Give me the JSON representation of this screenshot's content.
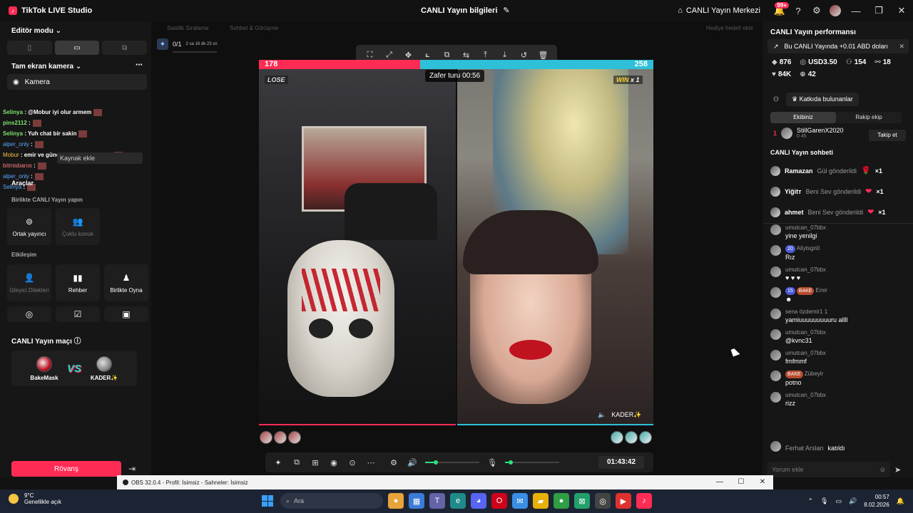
{
  "titlebar": {
    "app_title": "TikTok LIVE Studio",
    "center_title": "CANLI Yayın bilgileri",
    "center_btn": "CANLI Yayın Merkezi",
    "notif_count": "99+"
  },
  "left": {
    "editor_mode": "Editör modu",
    "fullscreen_camera": "Tam ekran kamera",
    "camera_item": "Kamera",
    "source_add": "Kaynak ekle",
    "tools": "Araçlar",
    "chat_overlay": [
      {
        "user": "Selinya",
        "text": ": @Mobur iyi olur armem",
        "ucls": "kg"
      },
      {
        "user": "pins2112",
        "text": ":",
        "ucls": "kg"
      },
      {
        "user": "Selinya",
        "text": ": Yuh chat bir sakin",
        "ucls": "kg"
      },
      {
        "user": "alper_only",
        "text": ":",
        "ucls": "kb"
      },
      {
        "user": "Mobur",
        "text": ": emir ve güneşten bahsediyorum",
        "ucls": "ky"
      },
      {
        "user": "bitmisbaros",
        "text": ":",
        "ucls": "km"
      },
      {
        "user": "alper_only",
        "text": ":",
        "ucls": "kb"
      },
      {
        "user": "Selinya",
        "text": ":",
        "ucls": "kb"
      }
    ],
    "together_title": "Birlikte CANLI Yayın yapın",
    "together_tiles": [
      {
        "label": "Ortak yayıncı",
        "icon": "⊚",
        "dim": false
      },
      {
        "label": "Çoklu konuk",
        "icon": "👥",
        "dim": true
      }
    ],
    "interaction_title": "Etkileşim",
    "interaction_tiles": [
      {
        "label": "İzleyici Dilekleri",
        "icon": "👤",
        "dim": true
      },
      {
        "label": "Rehber",
        "icon": "▮▮",
        "dim": false
      },
      {
        "label": "Birlikte Oyna",
        "icon": "♟",
        "dim": false
      }
    ],
    "match_title": "CANLI Yayın maçı",
    "match_left": "BakeMask",
    "match_right": "KADER✨",
    "vs": "VS",
    "rematch": "Rövanş"
  },
  "stage": {
    "faint_labels": [
      "Saatlik Sıralama",
      "Sohbet & Görüşme",
      "Hediye hedefi ekle"
    ],
    "goal_count": "0/1",
    "goal_time": "2 sa 16 dk 23 sn",
    "score_left": "178",
    "score_right": "258",
    "round_timer": "Zafer turu 00:56",
    "lose_label": "LOSE",
    "win_label": "WIN",
    "win_mult": "x 1",
    "opponent_name": "KADER✨",
    "live_time": "01:43:42",
    "toolbar_icons": [
      "⛶",
      "⤢",
      "✥",
      "⟀",
      "⧉",
      "⇆",
      "⤒",
      "⤓",
      "↺",
      "🗑"
    ],
    "controls": {
      "volume_level": 0.2,
      "mic_level": 0.1
    }
  },
  "right": {
    "perf_title": "CANLI Yayın performansı",
    "promo": "Bu CANLI Yayında +0.01 ABD doları",
    "stats_row1": [
      {
        "icon": "◆",
        "value": "876"
      },
      {
        "icon": "◎",
        "value": "USD3.50"
      },
      {
        "icon": "⚇",
        "value": "154"
      },
      {
        "icon": "⚯",
        "value": "18"
      }
    ],
    "stats_row2": [
      {
        "icon": "♥",
        "value": "84K"
      },
      {
        "icon": "⊕",
        "value": "42"
      }
    ],
    "contributors": "Katkıda bulunanlar",
    "tab_us": "Ekibiniz",
    "tab_rival": "Rakip ekip",
    "leader_rank": "1",
    "leader_name": "StillGarenX2020",
    "leader_sub": "0  45",
    "follow": "Takip et",
    "chat_title": "CANLI Yayın sohbeti",
    "gifts": [
      {
        "user": "Ramazan",
        "text": "Gül gönderildi",
        "icon": "🌹",
        "mul": "×1"
      },
      {
        "user": "Yiğitт",
        "text": "Beni Sev gönderildi",
        "icon": "❤",
        "mul": "×1"
      },
      {
        "user": "ahmet",
        "text": "Beni Sev gönderildi",
        "icon": "❤",
        "mul": "×1"
      }
    ],
    "messages": [
      {
        "name": "umutcan_07bbx",
        "text": "yine yenilgi",
        "lvl": "",
        "badge": ""
      },
      {
        "name": "Aliytsgn0",
        "text": "Rız",
        "lvl": "20",
        "badge": ""
      },
      {
        "name": "umutcan_07bbx",
        "text": "♥ ♥ ♥",
        "lvl": "",
        "badge": ""
      },
      {
        "name": "Emir",
        "text": "☻",
        "lvl": "15",
        "badge": "BAKE"
      },
      {
        "name": "sena özdemir1 1",
        "text": "yamiuuuuuuuuuru allll",
        "lvl": "",
        "badge": ""
      },
      {
        "name": "umutcan_07bbx",
        "text": "@kvnc31",
        "lvl": "",
        "badge": ""
      },
      {
        "name": "umutcan_07bbx",
        "text": "fmfmmf",
        "lvl": "",
        "badge": ""
      },
      {
        "name": "Zübeyir",
        "text": "potno",
        "lvl": "",
        "badge": "BAKE"
      },
      {
        "name": "umutcan_07bbx",
        "text": "rizz",
        "lvl": "",
        "badge": ""
      }
    ],
    "join_user": "Ferhat Arslan",
    "join_text": "katıldı",
    "comment_placeholder": "Yorum ekle"
  },
  "obs": {
    "title": "OBS 32.0.4 - Profil: İsimsiz - Sahneler: İsimsiz"
  },
  "taskbar": {
    "temp": "9°C",
    "weather": "Genellikle açık",
    "search": "Ara",
    "time": "00:57",
    "date": "8.02.2026"
  }
}
